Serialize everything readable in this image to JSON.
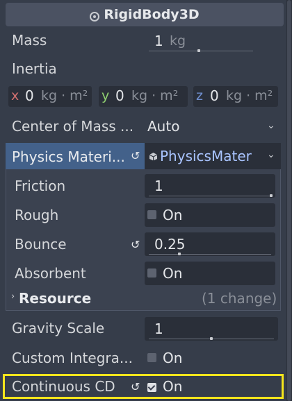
{
  "header": {
    "title": "RigidBody3D"
  },
  "props": {
    "mass": {
      "label": "Mass",
      "value": "1",
      "unit": "kg",
      "slider_fraction": 0.35
    },
    "inertia": {
      "label": "Inertia",
      "x_axis": "x",
      "x_value": "0",
      "y_axis": "y",
      "y_value": "0",
      "z_axis": "z",
      "z_value": "0",
      "unit": "kg · m²"
    },
    "center_of_mass": {
      "label": "Center of Mass ...",
      "value": "Auto"
    },
    "physics_material": {
      "label": "Physics Materi...",
      "value": "PhysicsMater"
    },
    "friction": {
      "label": "Friction",
      "value": "1",
      "slider_fraction": 1.0
    },
    "rough": {
      "label": "Rough",
      "checkbox_label": "On",
      "checked": false
    },
    "bounce": {
      "label": "Bounce",
      "value": "0.25",
      "slider_fraction": 0.25
    },
    "absorbent": {
      "label": "Absorbent",
      "checkbox_label": "On",
      "checked": false
    },
    "resource": {
      "label": "Resource",
      "changes": "(1 change)"
    },
    "gravity_scale": {
      "label": "Gravity Scale",
      "value": "1",
      "slider_fraction": 0.5
    },
    "custom_integrator": {
      "label": "Custom Integra...",
      "checkbox_label": "On",
      "checked": false
    },
    "continuous_cd": {
      "label": "Continuous CD",
      "checkbox_label": "On",
      "checked": true
    }
  },
  "colors": {
    "panel_bg": "#363d4a",
    "field_bg": "#2a2f39",
    "header_bg": "#4b5262",
    "subresource_header": "#43618a",
    "subresource_bg": "#3b4250",
    "highlight": "#f6e51c"
  },
  "icons": {
    "node": "node-icon",
    "revert": "revert-icon",
    "resource": "resource-cube-icon",
    "dropdown": "chevron-down-icon",
    "expand": "chevron-right-icon"
  }
}
